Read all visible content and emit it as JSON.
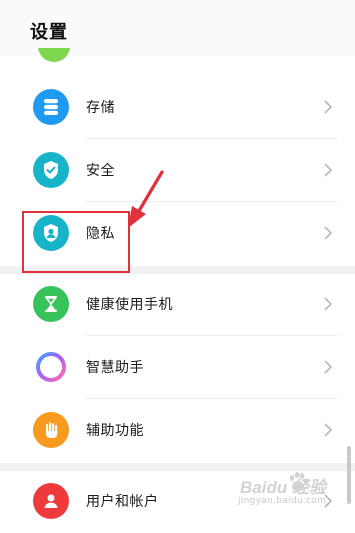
{
  "header": {
    "title": "设置"
  },
  "settings": {
    "storage": {
      "label": "存储",
      "icon": "storage-icon",
      "color": "#1e9bf0"
    },
    "security": {
      "label": "安全",
      "icon": "shield-check-icon",
      "color": "#17b3c9"
    },
    "privacy": {
      "label": "隐私",
      "icon": "privacy-shield-icon",
      "color": "#17b3c9"
    },
    "digital_balance": {
      "label": "健康使用手机",
      "icon": "hourglass-icon",
      "color": "#37c25a"
    },
    "assistant": {
      "label": "智慧助手",
      "icon": "assistant-ring-icon",
      "color": "#8c6cf2"
    },
    "accessibility": {
      "label": "辅助功能",
      "icon": "hand-icon",
      "color": "#f79a1d"
    },
    "accounts": {
      "label": "用户和帐户",
      "icon": "user-icon",
      "color": "#ee3a3a"
    }
  },
  "annotation": {
    "highlight_color": "#e0303b"
  },
  "watermark": {
    "text": "Baidu 经验",
    "sub": "jingyan.baidu.com"
  }
}
